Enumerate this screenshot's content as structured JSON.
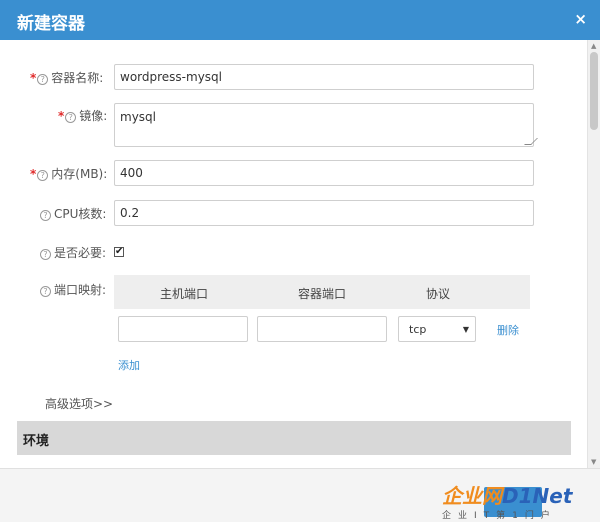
{
  "dialog": {
    "title": "新建容器",
    "close_symbol": "×"
  },
  "form": {
    "required_mark": "*",
    "help_symbol": "?",
    "name_label": "容器名称:",
    "name_value": "wordpress-mysql",
    "image_label": "镜像:",
    "image_value": "mysql",
    "memory_label": "内存(MB):",
    "memory_value": "400",
    "cpu_label": "CPU核数:",
    "cpu_value": "0.2",
    "required_label": "是否必要:",
    "required_checked": true,
    "check_symbol": "✔",
    "port_label": "端口映射:"
  },
  "ports": {
    "headers": [
      "主机端口",
      "容器端口",
      "协议"
    ],
    "rows": [
      {
        "host_port": "",
        "container_port": "",
        "protocol": "tcp",
        "delete_label": "删除"
      }
    ],
    "add_label": "添加"
  },
  "advanced_label": "高级选项>>",
  "env_section_label": "环境",
  "watermark": {
    "logo_a": "企业网",
    "logo_b": "D1Net",
    "sub": "企业IT第1门户"
  },
  "colors": {
    "header": "#3a8fd0",
    "required": "#e02b2b",
    "link": "#3a8fd0"
  }
}
